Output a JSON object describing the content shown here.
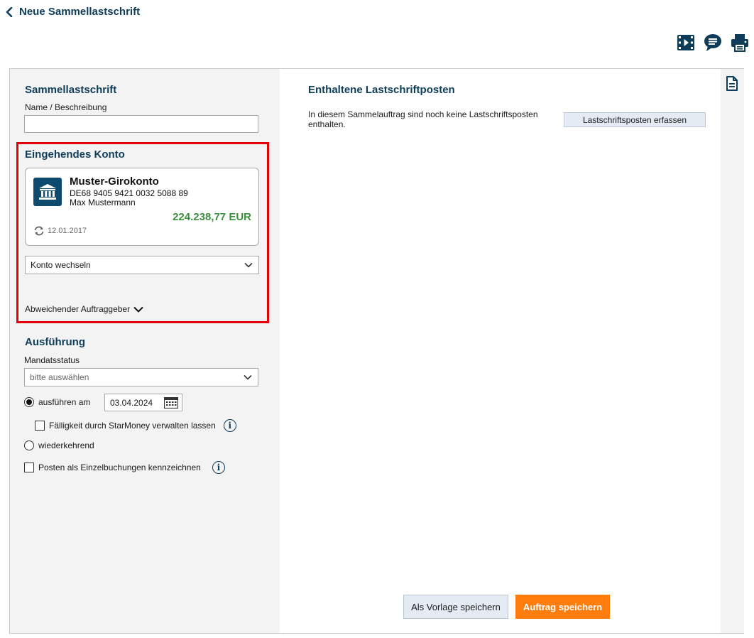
{
  "header": {
    "title": "Neue Sammellastschrift"
  },
  "toolbar": {
    "icons": [
      "video-icon",
      "chat-icon",
      "print-icon"
    ]
  },
  "sammellastschrift": {
    "heading": "Sammellastschrift",
    "name_label": "Name / Beschreibung",
    "name_value": ""
  },
  "konto": {
    "heading": "Eingehendes Konto",
    "account_name": "Muster-Girokonto",
    "iban": "DE68 9405 9421 0032 5088 89",
    "owner": "Max Mustermann",
    "balance": "224.238,77 EUR",
    "updated": "12.01.2017",
    "switch_label": "Konto wechseln",
    "deviating_label": "Abweichender Auftraggeber"
  },
  "ausfuehrung": {
    "heading": "Ausführung",
    "mandate_label": "Mandatsstatus",
    "mandate_placeholder": "bitte auswählen",
    "execute_on_label": "ausführen am",
    "execute_on_date": "03.04.2024",
    "execute_on_selected": true,
    "due_manage_label": "Fälligkeit durch StarMoney verwalten lassen",
    "due_manage_checked": false,
    "recurring_label": "wiederkehrend",
    "recurring_selected": false,
    "single_bookings_label": "Posten als Einzelbuchungen kennzeichnen",
    "single_bookings_checked": false
  },
  "main": {
    "heading": "Enthaltene Lastschriftposten",
    "empty_text": "In diesem Sammelauftrag sind noch keine Lastschriftsposten enthalten.",
    "capture_button": "Lastschriftsposten erfassen"
  },
  "footer": {
    "template_button": "Als Vorlage speichern",
    "save_button": "Auftrag speichern"
  },
  "colors": {
    "heading": "#0e3d5a",
    "highlight_border": "#e3000b",
    "balance": "#3a8f3e",
    "primary_button": "#ff7d0c",
    "secondary_button": "#e4ebf2"
  }
}
